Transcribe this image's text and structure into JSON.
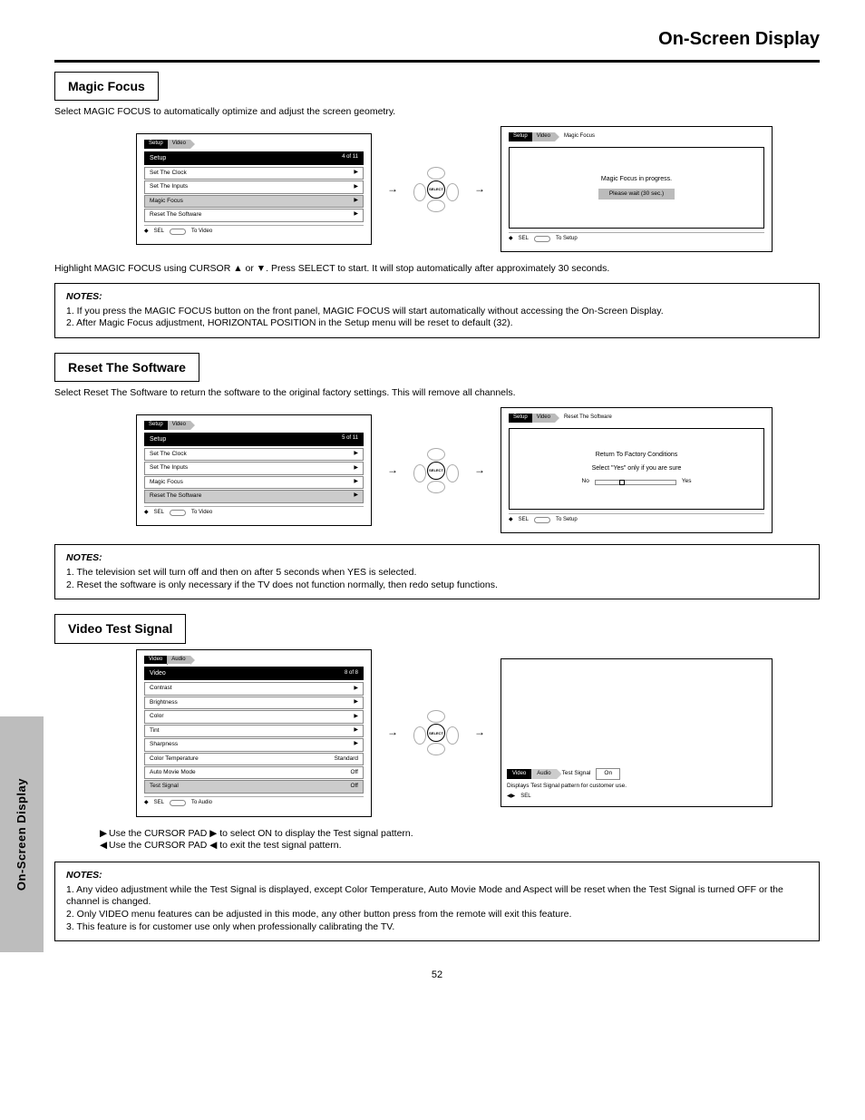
{
  "page": {
    "tab_label": "On-Screen Display",
    "title": "On-Screen Display",
    "number": "52"
  },
  "sections": {
    "magic": {
      "head": "Magic Focus",
      "sub": "Select MAGIC FOCUS to automatically optimize and adjust the screen geometry.",
      "left": {
        "crumb1": "Setup",
        "crumb2": "Video",
        "menu_title": "Setup",
        "items": [
          {
            "label": "Set The Clock",
            "right": "",
            "hl": false
          },
          {
            "label": "Set The Inputs",
            "right": "",
            "hl": false
          },
          {
            "label": "Magic Focus",
            "right": "",
            "hl": true
          },
          {
            "label": "Reset The Software",
            "right": "",
            "hl": false
          }
        ],
        "footer_sel": "SEL",
        "footer_ret": "To Video"
      },
      "right": {
        "crumb1": "Setup",
        "crumb2": "Video",
        "cap": "Magic Focus",
        "msg1": "Magic Focus in progress.",
        "msg2": "Please wait (30 sec.)",
        "footer_sel": "SEL",
        "footer_ret": "To Setup"
      },
      "after": "Highlight MAGIC FOCUS using CURSOR ▲ or ▼. Press SELECT to start. It will stop automatically after approximately 30 seconds.",
      "notes_lbl": "NOTES:",
      "notes": [
        "1. If you press the MAGIC FOCUS button on the front panel, MAGIC FOCUS will start automatically without accessing the On-Screen Display.",
        "2. After Magic Focus adjustment, HORIZONTAL POSITION in the Setup menu will be reset to default (32)."
      ]
    },
    "reset": {
      "head": "Reset The Software",
      "sub": "Select Reset The Software to return the software to the original factory settings. This will remove all channels.",
      "left": {
        "crumb1": "Setup",
        "crumb2": "Video",
        "menu_title": "Setup",
        "items": [
          {
            "label": "Set The Clock",
            "right": "",
            "hl": false
          },
          {
            "label": "Set The Inputs",
            "right": "",
            "hl": false
          },
          {
            "label": "Magic Focus",
            "right": "",
            "hl": false
          },
          {
            "label": "Reset The Software",
            "right": "",
            "hl": true
          }
        ],
        "footer_sel": "SEL",
        "footer_ret": "To Video"
      },
      "right": {
        "crumb1": "Setup",
        "crumb2": "Video",
        "cap": "Reset The Software",
        "msg1": "Return To Factory Conditions",
        "msg2": "Select \"Yes\" only if you are sure",
        "meter_no": "No",
        "meter_yes": "Yes",
        "footer_sel": "SEL",
        "footer_ret": "To Setup"
      },
      "notes_lbl": "NOTES:",
      "notes": [
        "1. The television set will turn off and then on after 5 seconds when YES is selected.",
        "2. Reset the software is only necessary if the TV does not function normally, then redo setup functions."
      ]
    },
    "test": {
      "head": "Video Test Signal",
      "left": {
        "crumb1": "Video",
        "crumb2": "Audio",
        "menu_title": "Video",
        "items": [
          {
            "label": "Contrast",
            "right": "",
            "hl": false
          },
          {
            "label": "Brightness",
            "right": "",
            "hl": false
          },
          {
            "label": "Color",
            "right": "",
            "hl": false
          },
          {
            "label": "Tint",
            "right": "",
            "hl": false
          },
          {
            "label": "Sharpness",
            "right": "",
            "hl": false
          },
          {
            "label": "Color Temperature",
            "right": "Standard",
            "hl": false
          },
          {
            "label": "Auto Movie Mode",
            "right": "Off",
            "hl": false
          },
          {
            "label": "Test Signal",
            "right": "Off",
            "hl": true
          }
        ],
        "footer_sel": "SEL",
        "footer_ret": "To Audio"
      },
      "right": {
        "bars": [
          "#fff",
          "#ff0",
          "#0ff",
          "#0f0",
          "#f0f",
          "#f00",
          "#00f",
          "#000"
        ],
        "crumb1": "Video",
        "crumb2": "Audio",
        "cap": "Test Signal",
        "val": "On",
        "desc": "Displays Test Signal pattern for customer use.",
        "footer_sel": "SEL"
      },
      "inst1": "Use the CURSOR PAD ▶ to select ON to display the Test signal pattern.",
      "inst2": "Use the CURSOR PAD ◀ to exit the test signal pattern.",
      "notes_lbl": "NOTES:",
      "notes": [
        "1. Any video adjustment while the Test Signal is displayed, except Color Temperature, Auto Movie Mode and Aspect will be reset when the Test Signal is turned OFF or the channel is changed.",
        "2. Only VIDEO menu features can be adjusted in this mode, any other button press from the remote will exit this feature.",
        "3. This feature is for customer use only when professionally calibrating the TV."
      ]
    }
  },
  "select_label": "SELECT"
}
